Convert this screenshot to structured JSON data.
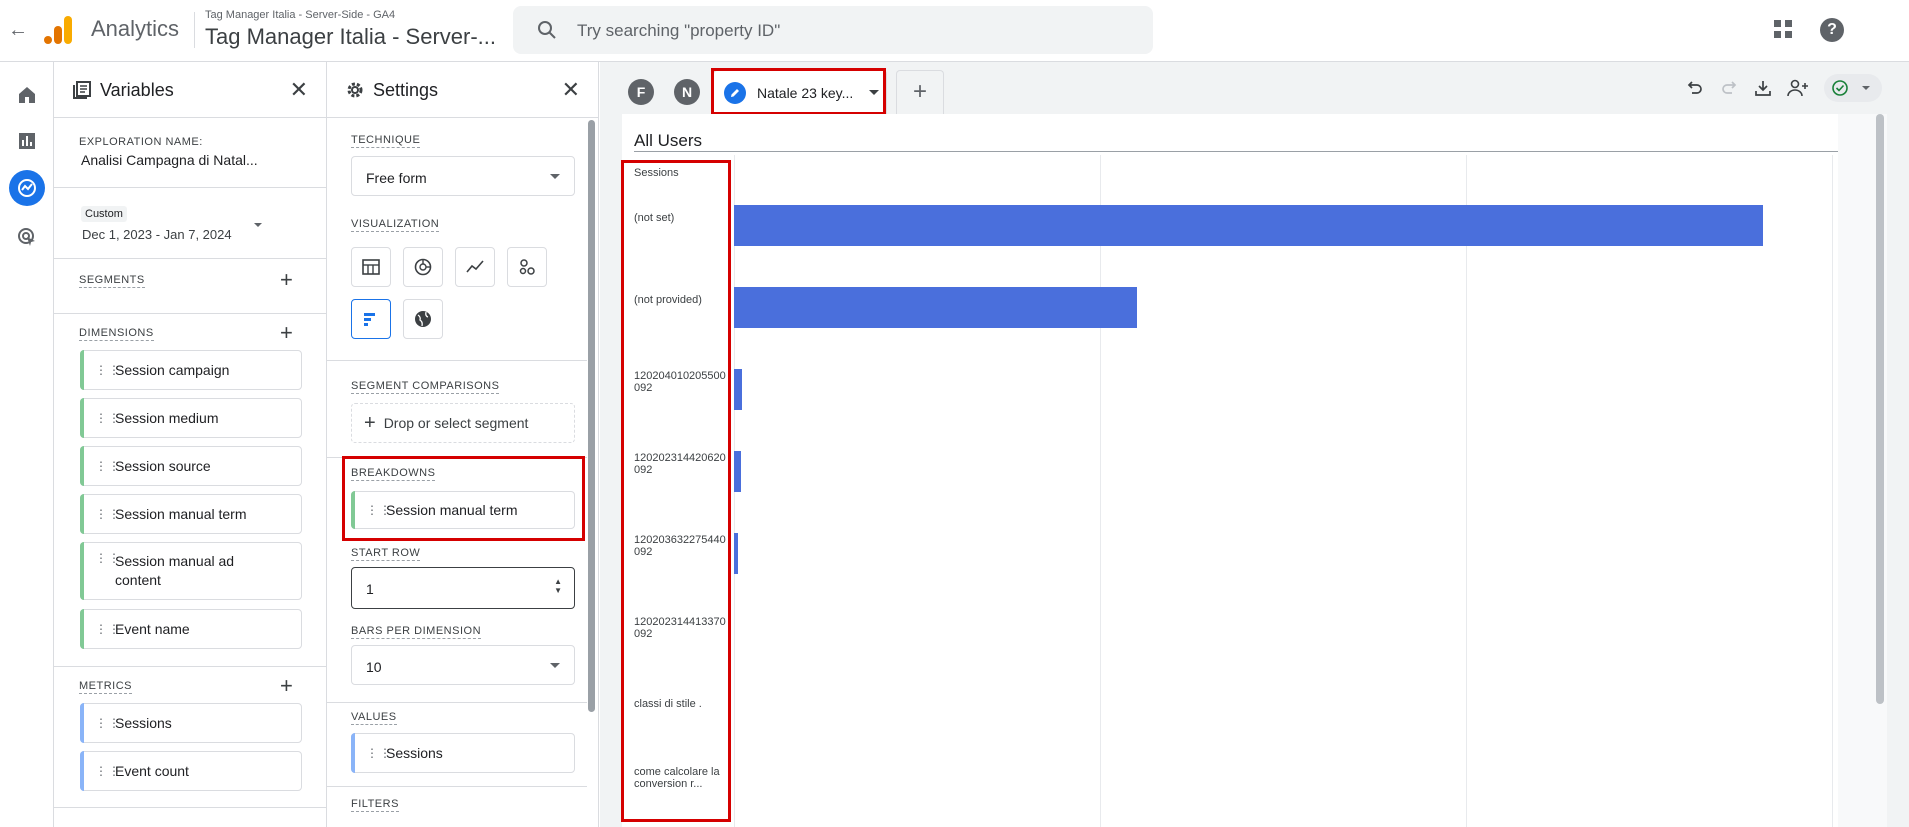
{
  "header": {
    "app_name": "Analytics",
    "account_small": "Tag Manager Italia - Server-Side - GA4",
    "account_big": "Tag Manager Italia - Server-...",
    "search_placeholder": "Try searching \"property ID\""
  },
  "variables": {
    "title": "Variables",
    "exploration_label": "EXPLORATION NAME:",
    "exploration_name": "Analisi Campagna di Natal...",
    "date_badge": "Custom",
    "date_range": "Dec 1, 2023 - Jan 7, 2024",
    "segments_label": "SEGMENTS",
    "dimensions_label": "DIMENSIONS",
    "dimensions": [
      "Session campaign",
      "Session medium",
      "Session source",
      "Session manual term",
      "Session manual ad content",
      "Event name"
    ],
    "metrics_label": "METRICS",
    "metrics": [
      "Sessions",
      "Event count"
    ]
  },
  "settings": {
    "title": "Settings",
    "technique_label": "TECHNIQUE",
    "technique_value": "Free form",
    "visualization_label": "VISUALIZATION",
    "segment_comparisons_label": "SEGMENT COMPARISONS",
    "drop_segment": "Drop or select segment",
    "breakdowns_label": "BREAKDOWNS",
    "breakdown_item": "Session manual term",
    "start_row_label": "START ROW",
    "start_row_value": "1",
    "bars_label": "BARS PER DIMENSION",
    "bars_value": "10",
    "values_label": "VALUES",
    "values_item": "Sessions",
    "filters_label": "FILTERS"
  },
  "tabs": {
    "tab_f": "F",
    "tab_n": "N",
    "active_tab": "Natale 23 key..."
  },
  "colors": {
    "bar": "#4a6fdc",
    "accent": "#1a73e8",
    "highlight": "#d50000"
  },
  "chart_data": {
    "type": "bar",
    "orientation": "horizontal",
    "title": "All Users",
    "metric_label": "Sessions",
    "categories": [
      "(not set)",
      "(not provided)",
      "120204010205500092",
      "120202314420620092",
      "120203632275440092",
      "120202314413370092",
      "classi di stile .",
      "come calcolare la conversion r..."
    ],
    "values": [
      2810,
      1100,
      22,
      18,
      10,
      0,
      0,
      0
    ],
    "xlim": [
      0,
      3000
    ],
    "grid": true
  }
}
